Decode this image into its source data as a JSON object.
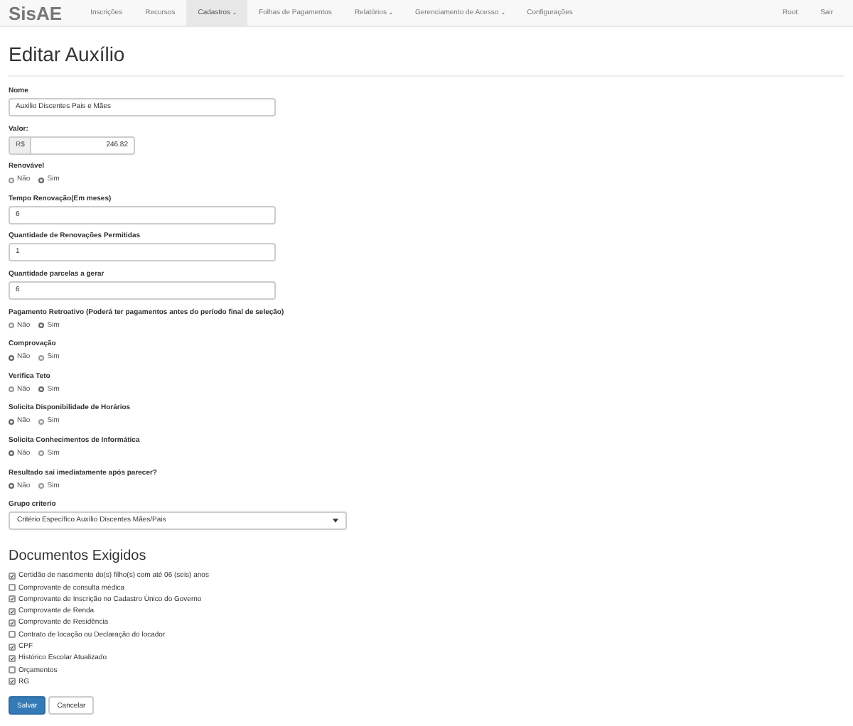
{
  "navbar": {
    "brand": "SisAE",
    "items": [
      {
        "label": "Inscrições",
        "selected": false,
        "dropdown": false
      },
      {
        "label": "Recursos",
        "selected": false,
        "dropdown": false
      },
      {
        "label": "Cadastros",
        "selected": true,
        "dropdown": true
      },
      {
        "label": "Folhas de Pagamentos",
        "selected": false,
        "dropdown": false
      },
      {
        "label": "Relatórios",
        "selected": false,
        "dropdown": true
      },
      {
        "label": "Gerenciamento de Acesso",
        "selected": false,
        "dropdown": true
      },
      {
        "label": "Configurações",
        "selected": false,
        "dropdown": false
      }
    ],
    "right_items": [
      "Root",
      "Sair"
    ]
  },
  "title": "Editar Auxílio",
  "fields": [
    {
      "kind": "text",
      "label": "Nome",
      "value": "Auxilio Discentes Pais e Mães"
    },
    {
      "kind": "currency",
      "label": "Valor:",
      "prefix": "R$",
      "value": "246.82"
    },
    {
      "kind": "radio",
      "label": "Renovável",
      "options": [
        {
          "label": "Não",
          "selected": false
        },
        {
          "label": "Sim",
          "selected": true
        }
      ]
    },
    {
      "kind": "text",
      "label": "Tempo Renovação(Em meses)",
      "value": "6"
    },
    {
      "kind": "text",
      "label": "Quantidade de Renovações Permitidas",
      "value": "1"
    },
    {
      "kind": "text",
      "label": "Quantidade parcelas a gerar",
      "value": "6"
    },
    {
      "kind": "radio",
      "label": "Pagamento Retroativo (Poderá ter pagamentos antes do período final de seleção)",
      "options": [
        {
          "label": "Não",
          "selected": false
        },
        {
          "label": "Sim",
          "selected": true
        }
      ]
    },
    {
      "kind": "radio",
      "label": "Comprovação",
      "options": [
        {
          "label": "Não",
          "selected": true
        },
        {
          "label": "Sim",
          "selected": false
        }
      ]
    },
    {
      "kind": "radio",
      "label": "Verifica Teto",
      "options": [
        {
          "label": "Não",
          "selected": false
        },
        {
          "label": "Sim",
          "selected": true
        }
      ]
    },
    {
      "kind": "radio",
      "label": "Solicita Disponibilidade de Horários",
      "options": [
        {
          "label": "Não",
          "selected": true
        },
        {
          "label": "Sim",
          "selected": false
        }
      ]
    },
    {
      "kind": "radio",
      "label": "Solicita Conhecimentos de Informática",
      "options": [
        {
          "label": "Não",
          "selected": true
        },
        {
          "label": "Sim",
          "selected": false
        }
      ]
    },
    {
      "kind": "radio",
      "label": "Resultado sai imediatamente após parecer?",
      "options": [
        {
          "label": "Não",
          "selected": true
        },
        {
          "label": "Sim",
          "selected": false
        }
      ]
    },
    {
      "kind": "select",
      "label": "Grupo criterio",
      "value": "Critério Específico Auxílio Discentes Mães/Pais"
    }
  ],
  "documents": {
    "heading": "Documentos Exigidos",
    "items": [
      {
        "label": "Certidão de nascimento do(s) filho(s) com até 06 (seis) anos",
        "checked": true
      },
      {
        "label": "Comprovante de consulta médica",
        "checked": false
      },
      {
        "label": "Comprovante de Inscrição no Cadastro Único do Governo",
        "checked": true
      },
      {
        "label": "Comprovante de Renda",
        "checked": true
      },
      {
        "label": "Comprovante de Residência",
        "checked": true
      },
      {
        "label": "Contrato de locação ou Declaração do locador",
        "checked": false
      },
      {
        "label": "CPF",
        "checked": true
      },
      {
        "label": "Histórico Escolar Atualizado",
        "checked": true
      },
      {
        "label": "Orçamentos",
        "checked": false
      },
      {
        "label": "RG",
        "checked": true
      }
    ]
  },
  "buttons": [
    {
      "label": "Salvar",
      "kind": "primary"
    },
    {
      "label": "Cancelar",
      "kind": "default"
    }
  ]
}
